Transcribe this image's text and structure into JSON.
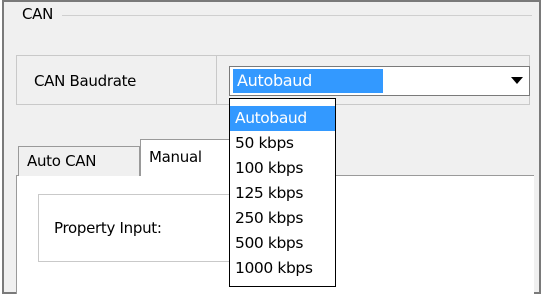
{
  "group": {
    "title": "CAN"
  },
  "baudrate": {
    "label": "CAN Baudrate",
    "selected": "Autobaud"
  },
  "dropdown": {
    "options": [
      "Autobaud",
      "50 kbps",
      "100 kbps",
      "125 kbps",
      "250 kbps",
      "500 kbps",
      "1000 kbps"
    ],
    "highlighted_index": 0
  },
  "tabs": [
    {
      "label": "Auto CAN",
      "active": false
    },
    {
      "label": "Manual",
      "active": true
    }
  ],
  "manual_panel": {
    "property_label": "Property Input:"
  },
  "colors": {
    "selection": "#3399ff",
    "window_bg": "#f0f0f0"
  },
  "icons": {
    "combo_arrow": "chevron-down-icon"
  }
}
